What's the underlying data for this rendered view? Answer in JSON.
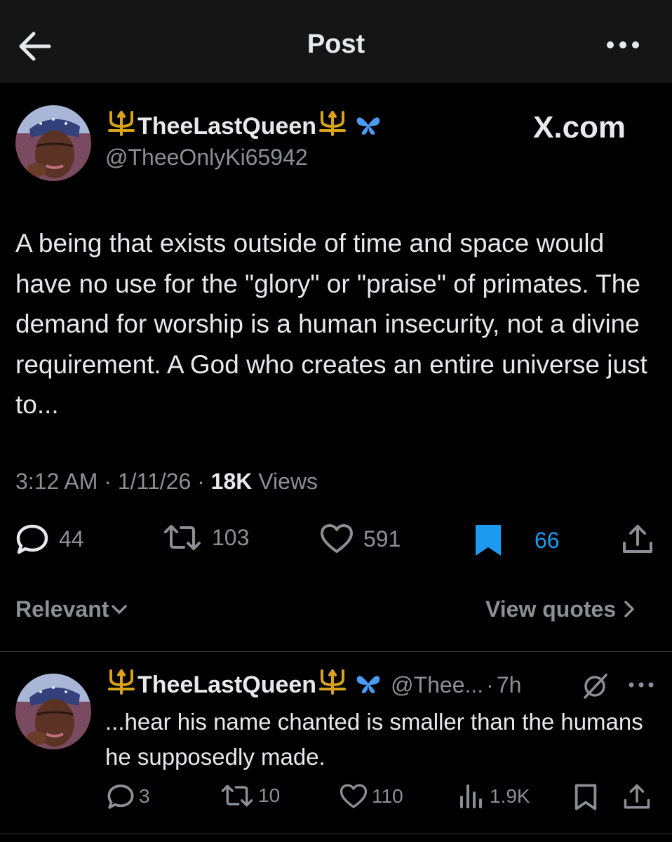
{
  "header": {
    "title": "Post"
  },
  "post": {
    "display_name": "TheeLastQueen",
    "handle": "@TheeOnlyKi65942",
    "brand": "X.com",
    "text": "A being that exists outside of time and space would have no use for the \"glory\" or \"praise\" of primates. The demand for worship is a human insecurity, not a divine requirement. A God who creates an entire universe just to...",
    "time": "3:12 AM",
    "date": "1/11/26",
    "sep": "·",
    "views_count": "18K",
    "views_label": "Views",
    "replies": "44",
    "reposts": "103",
    "likes": "591",
    "bookmarks": "66"
  },
  "sort": {
    "relevant_label": "Relevant",
    "view_quotes_label": "View quotes"
  },
  "reply": {
    "display_name": "TheeLastQueen",
    "handle": "@Thee...",
    "sep": "·",
    "time": "7h",
    "text": "...hear his name chanted is smaller than the humans he supposedly made.",
    "replies": "3",
    "reposts": "10",
    "likes": "110",
    "views": "1.9K"
  },
  "colors": {
    "background": "#000000",
    "topbar": "#151515",
    "text": "#e7e9ea",
    "muted": "#8b9096",
    "accent": "#1d9bf0",
    "trident": "#d9a21b"
  },
  "icons": [
    "back-arrow-icon",
    "more-icon",
    "trident-icon",
    "butterfly-icon",
    "reply-icon",
    "retweet-icon",
    "heart-icon",
    "bookmark-icon",
    "share-icon",
    "chevron-down-icon",
    "chevron-right-icon",
    "grok-icon",
    "views-icon"
  ]
}
